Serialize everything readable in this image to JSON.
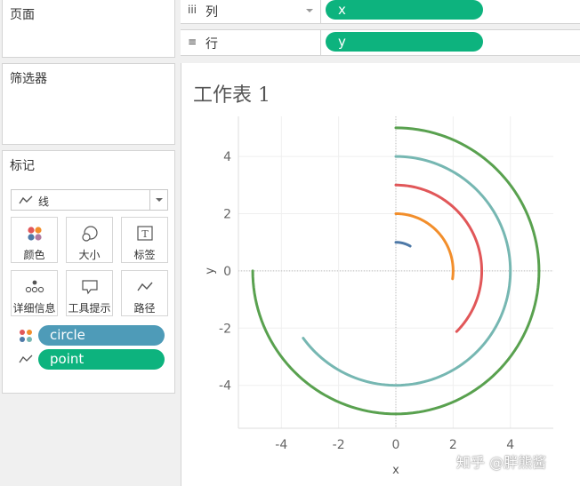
{
  "pages": {
    "title": "页面"
  },
  "filters": {
    "title": "筛选器"
  },
  "marks": {
    "title": "标记",
    "mark_type": "线",
    "buttons": [
      {
        "label": "颜色",
        "icon": "color-dots-icon"
      },
      {
        "label": "大小",
        "icon": "size-circles-icon"
      },
      {
        "label": "标签",
        "icon": "label-text-icon"
      },
      {
        "label": "详细信息",
        "icon": "detail-dots-icon"
      },
      {
        "label": "工具提示",
        "icon": "tooltip-bubble-icon"
      },
      {
        "label": "路径",
        "icon": "path-line-icon"
      }
    ],
    "pills": [
      {
        "label": "circle",
        "role": "color",
        "color": "#4e9bb8"
      },
      {
        "label": "point",
        "role": "path",
        "color": "#0db37e"
      }
    ]
  },
  "shelves": {
    "columns": {
      "label": "列",
      "icon": "iii",
      "pill": "x"
    },
    "rows": {
      "label": "行",
      "icon": "≡",
      "pill": "y"
    }
  },
  "worksheet": {
    "title": "工作表 1"
  },
  "chart_data": {
    "type": "line",
    "xlabel": "x",
    "ylabel": "y",
    "xlim": [
      -5.5,
      5.5
    ],
    "ylim": [
      -5.5,
      5.4
    ],
    "x_ticks": [
      -4,
      -2,
      0,
      2,
      4
    ],
    "y_ticks": [
      4,
      2,
      0,
      -2,
      -4
    ],
    "grid": true,
    "zero_lines": "dotted",
    "series": [
      {
        "radius": 1,
        "start_angle_deg": 90,
        "end_angle_deg": 60,
        "color": "#4e79a7"
      },
      {
        "radius": 2,
        "start_angle_deg": 90,
        "end_angle_deg": -8,
        "color": "#f28e2b"
      },
      {
        "radius": 3,
        "start_angle_deg": 90,
        "end_angle_deg": -45,
        "color": "#e15759"
      },
      {
        "radius": 4,
        "start_angle_deg": 90,
        "end_angle_deg": -144,
        "color": "#76b7b2"
      },
      {
        "radius": 5,
        "start_angle_deg": 90,
        "end_angle_deg": -180,
        "color": "#59a14f"
      }
    ]
  },
  "watermark": "知乎 @胖熊酱"
}
